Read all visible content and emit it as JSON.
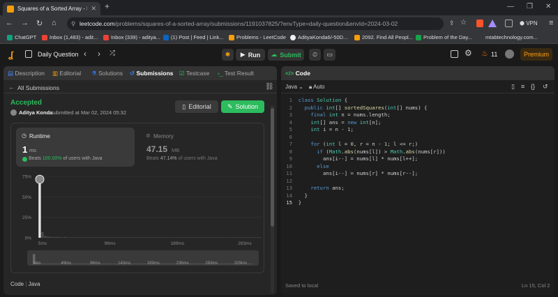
{
  "browser": {
    "tab_title": "Squares of a Sorted Array - Lee",
    "url_domain": "leetcode.com",
    "url_path": "/problems/squares-of-a-sorted-array/submissions/1191037825/?envType=daily-question&envId=2024-03-02",
    "vpn_label": "VPN",
    "bookmarks": [
      "ChatGPT",
      "Inbox (1,483) - adit...",
      "Inbox (339) - aditya...",
      "(1) Post | Feed | Link...",
      "Problems - LeetCode",
      "AdityaKonda6/-50D...",
      "2092. Find All Peopl...",
      "Problem of the Day...",
      "mtabtechnology.com..."
    ]
  },
  "nav": {
    "title": "Daily Question",
    "run_label": "Run",
    "submit_label": "Submit",
    "streak": "11",
    "premium_label": "Premium"
  },
  "left_panel": {
    "tabs": [
      "Description",
      "Editorial",
      "Solutions",
      "Submissions",
      "Testcase",
      "Test Result"
    ],
    "back_label": "All Submissions",
    "status": "Accepted",
    "user": "Aditya Konda",
    "submitted_text": "submitted at Mar 02, 2024 05:32",
    "editorial_btn": "Editorial",
    "solution_btn": "Solution",
    "runtime": {
      "label": "Runtime",
      "value": "1",
      "unit": "ms",
      "beats_label": "Beats",
      "beats_pct": "100.00%",
      "beats_suffix": "of users with Java"
    },
    "memory": {
      "label": "Memory",
      "value": "47.15",
      "unit": "MB",
      "beats_label": "Beats",
      "beats_pct": "47.14%",
      "beats_suffix": "of users with Java"
    },
    "footer_code_label": "Code",
    "footer_lang": "Java"
  },
  "chart_data": {
    "type": "bar",
    "y_ticks": [
      "75%",
      "50%",
      "25%",
      "0%"
    ],
    "ylim": [
      0,
      75
    ],
    "x_ticks": [
      "5ms",
      "96ms",
      "189ms",
      "283ms"
    ],
    "mini_x_ticks": [
      "3ms",
      "49ms",
      "96ms",
      "143ms",
      "189ms",
      "236ms",
      "283ms",
      "329ms"
    ],
    "values": [
      68,
      7,
      2,
      1.5,
      1,
      1,
      1,
      1,
      0.5,
      1,
      0.5,
      0.5,
      0.5,
      0.5,
      0.5,
      0.5,
      0.5,
      0.5,
      0.5,
      0.5,
      0.5,
      0.5,
      0.5,
      0.5,
      0.5,
      0.5,
      0.5,
      0.5,
      0.5,
      0.5,
      0.5,
      0.5,
      0.5,
      0.5,
      0.5,
      0.5,
      0.5,
      0.5,
      0.5,
      0.5,
      0.5,
      0.5,
      0.5,
      0.5,
      0.5,
      0.5,
      0.5,
      0.5,
      0.5,
      0.5,
      0.5,
      0.5,
      0.5,
      0.5,
      0.5,
      0.5,
      0.5,
      0.5,
      0.5,
      0.5,
      0.5,
      0.5,
      0.5,
      0.5,
      0.5,
      0.5,
      0.5,
      0.5,
      0.5,
      0.5,
      0.5,
      0.5,
      0.5,
      0.5,
      0.5,
      0.5,
      0.5,
      0.5,
      0.5,
      0.5
    ],
    "colors": {
      "bar": "#4a4a4a",
      "highlight": "#e5e5e5"
    }
  },
  "editor": {
    "title": "Code",
    "language": "Java",
    "autosave": "Auto",
    "lines": [
      [
        [
          "kw",
          "class "
        ],
        [
          "ty",
          "Solution"
        ],
        [
          "tx",
          " {"
        ]
      ],
      [
        [
          "tx",
          "  "
        ],
        [
          "kw",
          "public "
        ],
        [
          "ty",
          "int"
        ],
        [
          "tx",
          "[] "
        ],
        [
          "fn",
          "sortedSquares"
        ],
        [
          "tx",
          "("
        ],
        [
          "ty",
          "int"
        ],
        [
          "tx",
          "[] nums) {"
        ]
      ],
      [
        [
          "tx",
          "    "
        ],
        [
          "kw",
          "final "
        ],
        [
          "ty",
          "int"
        ],
        [
          "tx",
          " n = nums.length;"
        ]
      ],
      [
        [
          "tx",
          "    "
        ],
        [
          "ty",
          "int"
        ],
        [
          "tx",
          "[] ans = "
        ],
        [
          "kw",
          "new "
        ],
        [
          "ty",
          "int"
        ],
        [
          "tx",
          "[n];"
        ]
      ],
      [
        [
          "tx",
          "    "
        ],
        [
          "ty",
          "int"
        ],
        [
          "tx",
          " i = n - "
        ],
        [
          "nm",
          "1"
        ],
        [
          "tx",
          ";"
        ]
      ],
      [],
      [
        [
          "tx",
          "    "
        ],
        [
          "kw",
          "for "
        ],
        [
          "tx",
          "("
        ],
        [
          "ty",
          "int"
        ],
        [
          "tx",
          " l = "
        ],
        [
          "nm",
          "0"
        ],
        [
          "tx",
          ", r = n - "
        ],
        [
          "nm",
          "1"
        ],
        [
          "tx",
          "; l <= r;)"
        ]
      ],
      [
        [
          "tx",
          "      "
        ],
        [
          "kw",
          "if "
        ],
        [
          "tx",
          "("
        ],
        [
          "ty",
          "Math"
        ],
        [
          "tx",
          "."
        ],
        [
          "fn",
          "abs"
        ],
        [
          "tx",
          "(nums[l]) > "
        ],
        [
          "ty",
          "Math"
        ],
        [
          "tx",
          "."
        ],
        [
          "fn",
          "abs"
        ],
        [
          "tx",
          "(nums[r]))"
        ]
      ],
      [
        [
          "tx",
          "        ans[i--] = nums[l] * nums[l++];"
        ]
      ],
      [
        [
          "tx",
          "      "
        ],
        [
          "kw",
          "else"
        ]
      ],
      [
        [
          "tx",
          "        ans[i--] = nums[r] * nums[r--];"
        ]
      ],
      [],
      [
        [
          "tx",
          "    "
        ],
        [
          "kw",
          "return "
        ],
        [
          "tx",
          "ans;"
        ]
      ],
      [
        [
          "tx",
          "  }"
        ]
      ],
      [
        [
          "tx",
          "}"
        ]
      ]
    ],
    "status_left": "Saved to local",
    "status_right": "Ln 15, Col 2"
  }
}
